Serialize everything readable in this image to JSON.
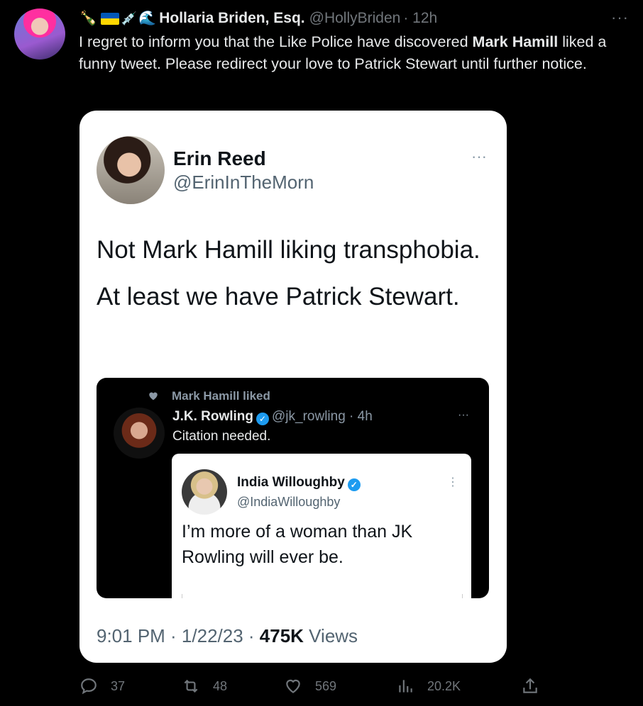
{
  "tweet": {
    "display_name": "Hollaria Briden, Esq.",
    "handle": "@HollyBriden",
    "time": "· 12h",
    "more_label": "···",
    "text_parts": [
      "I regret to inform you that the Like Police have discovered ",
      "Mark Hamill",
      " liked a funny tweet.  Please redirect your love to Patrick Stewart until further notice."
    ],
    "emoji_prefix": [
      "💫",
      "🇺🇦",
      "💉",
      "🌊"
    ]
  },
  "card": {
    "name": "Erin Reed",
    "handle": "@ErinInTheMorn",
    "more_label": "···",
    "line1": "Not Mark Hamill liking transphobia.",
    "line2": "At least we have Patrick Stewart.",
    "embed": {
      "liked_text": "Mark Hamill liked",
      "author": "J.K. Rowling",
      "author_handle": "@jk_rowling · 4h",
      "text": "Citation needed.",
      "more_label": "···",
      "quoted": {
        "name": "India Willoughby",
        "handle": "@IndiaWilloughby",
        "text": "I’m more of a woman than JK Rowling will ever be.",
        "more_label": "⋮"
      }
    },
    "meta_time": "9:01 PM · 1/22/23 · ",
    "meta_views_count": "475K",
    "meta_views_label": " Views"
  },
  "actions": {
    "replies": "37",
    "retweets": "48",
    "likes": "569",
    "views": "20.2K"
  },
  "colors": {
    "background": "#000000",
    "text": "#e7e9ea",
    "muted": "#71767b",
    "accent": "#1d9bf0"
  }
}
